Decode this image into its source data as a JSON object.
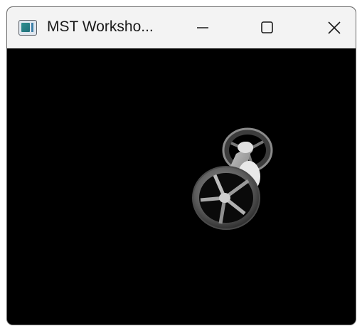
{
  "window": {
    "title": "MST Worksho...",
    "controls": {
      "minimize_icon": "minimize-icon",
      "maximize_icon": "maximize-icon",
      "close_icon": "close-icon"
    },
    "app_icon": "app-window-icon"
  },
  "viewport": {
    "background_color": "#000000",
    "scene_object": "spoked-wheel-assembly"
  }
}
